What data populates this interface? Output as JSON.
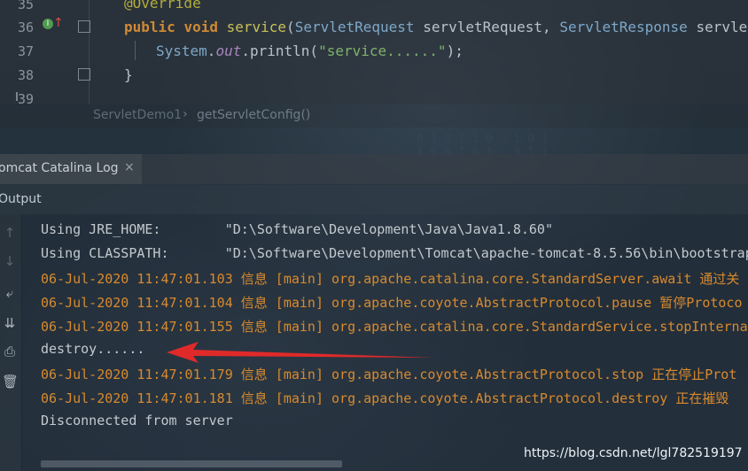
{
  "editor": {
    "line_numbers": [
      "35",
      "36",
      "37",
      "38",
      "39"
    ],
    "lines": {
      "l35": "@Override",
      "l36_kw1": "public",
      "l36_kw2": "void",
      "l36_meth": "service",
      "l36_p1type": "ServletRequest",
      "l36_p1name": "servletRequest",
      "l36_p2type": "ServletResponse",
      "l36_p2name": "servletRes",
      "l37_cls": "System",
      "l37_field": "out",
      "l37_call": "println",
      "l37_str": "\"service......\"",
      "l38": "}"
    },
    "breadcrumb": {
      "class": "ServletDemo1",
      "method": "getServletConfig()"
    }
  },
  "tool_window": {
    "tab_label": "omcat Catalina Log",
    "tab_close": "×",
    "output_label": "Output"
  },
  "sidebar_icons": [
    "arrow-up-icon",
    "arrow-down-icon",
    "soft-wrap-icon",
    "scroll-to-end-icon",
    "print-icon",
    "trash-icon"
  ],
  "console": {
    "lines": [
      {
        "text": "Using JRE_HOME:        \"D:\\Software\\Development\\Java\\Java1.8.60\"",
        "kind": "info"
      },
      {
        "text": "Using CLASSPATH:       \"D:\\Software\\Development\\Tomcat\\apache-tomcat-8.5.56\\bin\\bootstrap",
        "kind": "info"
      },
      {
        "text": "06-Jul-2020 11:47:01.103 信息 [main] org.apache.catalina.core.StandardServer.await 通过关",
        "kind": "log"
      },
      {
        "text": "06-Jul-2020 11:47:01.104 信息 [main] org.apache.coyote.AbstractProtocol.pause 暂停Protoco",
        "kind": "log"
      },
      {
        "text": "06-Jul-2020 11:47:01.155 信息 [main] org.apache.catalina.core.StandardService.stopInterna",
        "kind": "log"
      },
      {
        "text": "destroy......",
        "kind": "info"
      },
      {
        "text": "06-Jul-2020 11:47:01.179 信息 [main] org.apache.coyote.AbstractProtocol.stop 正在停止Prot",
        "kind": "log"
      },
      {
        "text": "06-Jul-2020 11:47:01.181 信息 [main] org.apache.coyote.AbstractProtocol.destroy 正在摧毁",
        "kind": "log"
      },
      {
        "text": "Disconnected from server",
        "kind": "info"
      }
    ]
  },
  "annotation": {
    "arrow_color": "#e02a2a"
  },
  "watermark": "https://blog.csdn.net/lgl782519197",
  "colors": {
    "log_orange": "#d88a2e",
    "keyword": "#d08a34",
    "string": "#7fb26a"
  }
}
